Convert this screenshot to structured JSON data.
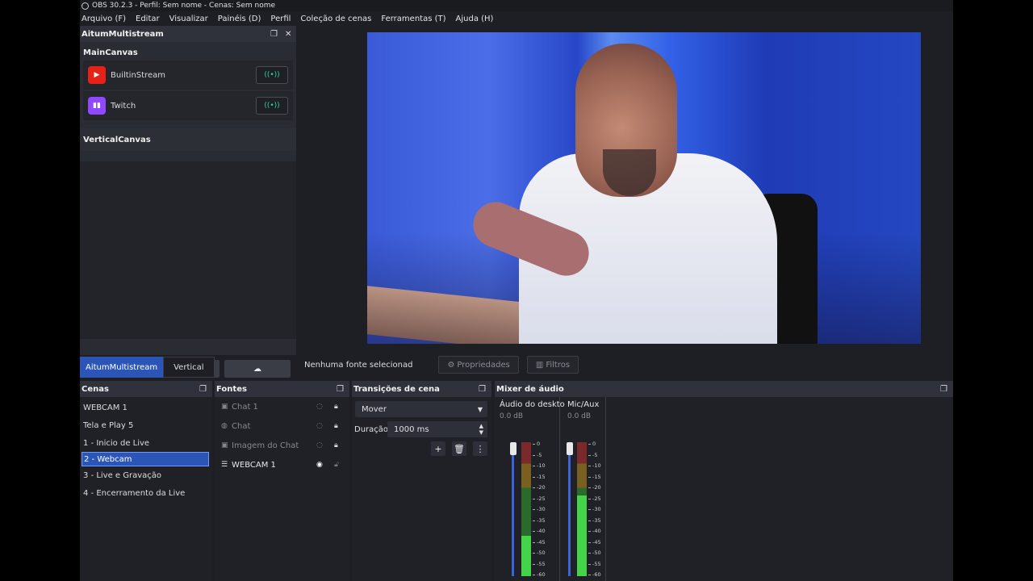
{
  "window": {
    "title": "OBS 30.2.3 - Perfil: Sem nome - Cenas: Sem nome"
  },
  "menu": [
    "Arquivo (F)",
    "Editar",
    "Visualizar",
    "Painéis (D)",
    "Perfil",
    "Coleção de cenas",
    "Ferramentas (T)",
    "Ajuda (H)"
  ],
  "multistream": {
    "dock_title": "AitumMultistream",
    "main_canvas": "MainCanvas",
    "streams": [
      {
        "name": "BuiltinStream",
        "icon": "youtube-icon"
      },
      {
        "name": "Twitch",
        "icon": "twitch-icon"
      }
    ],
    "vertical_canvas": "VerticalCanvas",
    "tabs": [
      "AitumMultistream",
      "Vertical"
    ]
  },
  "status": {
    "no_source": "Nenhuma fonte selecionad",
    "properties": "Propriedades",
    "filters": "Filtros"
  },
  "scenes": {
    "title": "Cenas",
    "items": [
      "WEBCAM 1",
      "Tela e Play 5",
      "1 - Inicio de Live",
      "2 - Webcam",
      "3 - Live e Gravação",
      "4 - Encerramento da Live"
    ],
    "selected": "2 - Webcam"
  },
  "sources": {
    "title": "Fontes",
    "items": [
      {
        "name": "Chat 1",
        "icon": "image-icon",
        "visible": false
      },
      {
        "name": "Chat",
        "icon": "browser-icon",
        "visible": false
      },
      {
        "name": "Imagem do Chat",
        "icon": "image-icon",
        "visible": false
      },
      {
        "name": "WEBCAM 1",
        "icon": "list-icon",
        "visible": true
      }
    ]
  },
  "transitions": {
    "title": "Transições de cena",
    "selected": "Mover",
    "duration_label": "Duração",
    "duration_value": "1000 ms"
  },
  "mixer": {
    "title": "Mixer de áudio",
    "channels": [
      {
        "name": "Áudio do deskto",
        "db": "0.0 dB",
        "level": 0.3
      },
      {
        "name": "Mic/Aux",
        "db": "0.0 dB",
        "level": 0.6
      }
    ],
    "scale": [
      "0",
      "-5",
      "-10",
      "-15",
      "-20",
      "-25",
      "-30",
      "-35",
      "-40",
      "-45",
      "-50",
      "-55",
      "-60"
    ]
  }
}
